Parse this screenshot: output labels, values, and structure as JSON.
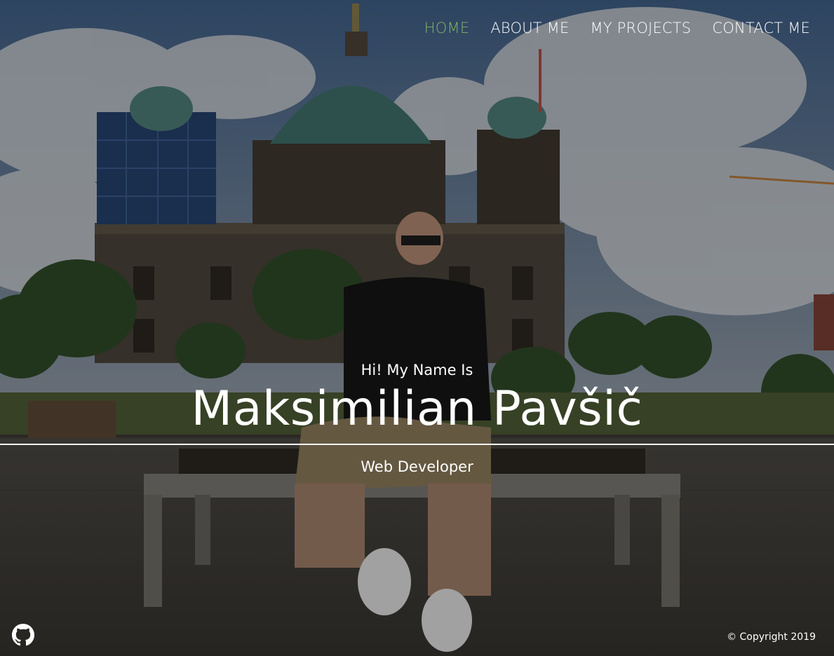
{
  "nav": {
    "items": [
      {
        "label": "HOME",
        "active": true
      },
      {
        "label": "ABOUT ME",
        "active": false
      },
      {
        "label": "MY PROJECTS",
        "active": false
      },
      {
        "label": "CONTACT ME",
        "active": false
      }
    ],
    "active_color": "#7fb36b"
  },
  "hero": {
    "greeting": "Hi! My Name Is",
    "name": "Maksimilian Pavšič",
    "role": "Web Developer"
  },
  "footer": {
    "github_icon": "github-icon",
    "copyright": "© Copyright 2019"
  }
}
